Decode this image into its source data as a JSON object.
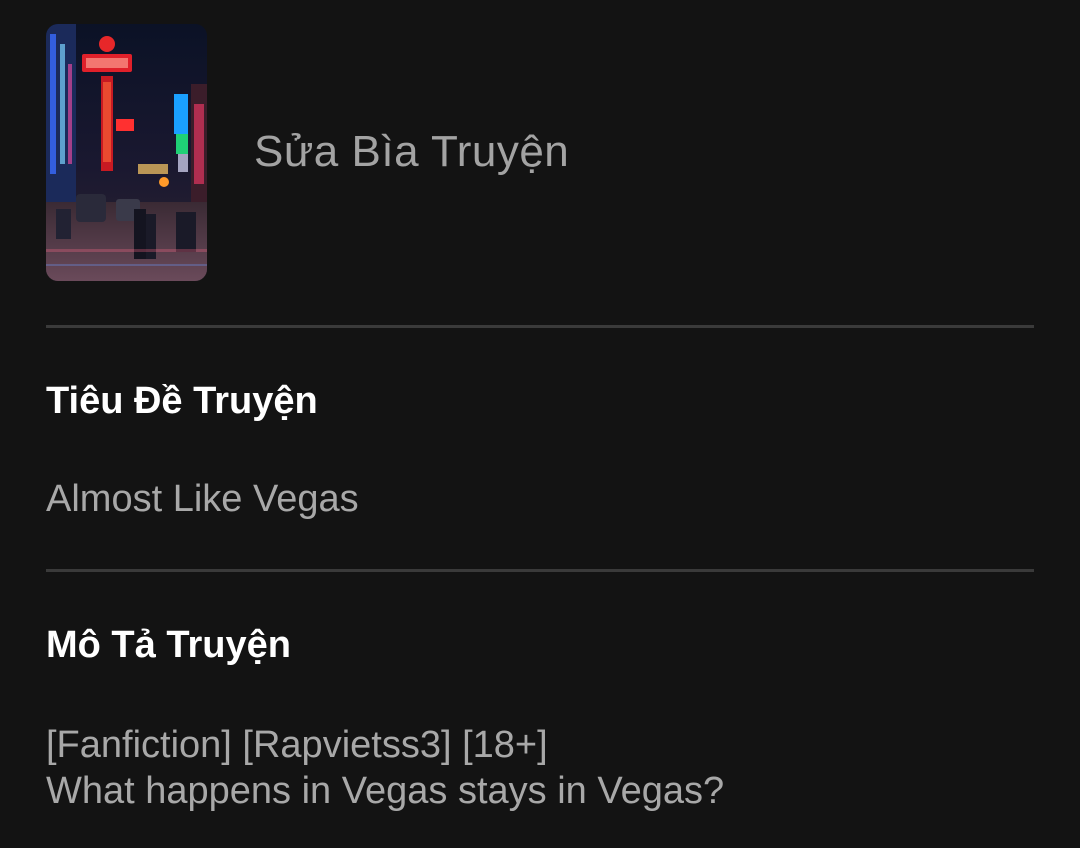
{
  "cover": {
    "image_alt": "Neon-lit night street scene",
    "edit_label": "Sửa Bìa Truyện"
  },
  "story_title": {
    "label": "Tiêu Đề Truyện",
    "value": "Almost Like Vegas"
  },
  "story_description": {
    "label": "Mô Tả Truyện",
    "lines": [
      "[Fanfiction] [Rapvietss3] [18+]",
      "What happens in Vegas stays in Vegas?"
    ]
  }
}
